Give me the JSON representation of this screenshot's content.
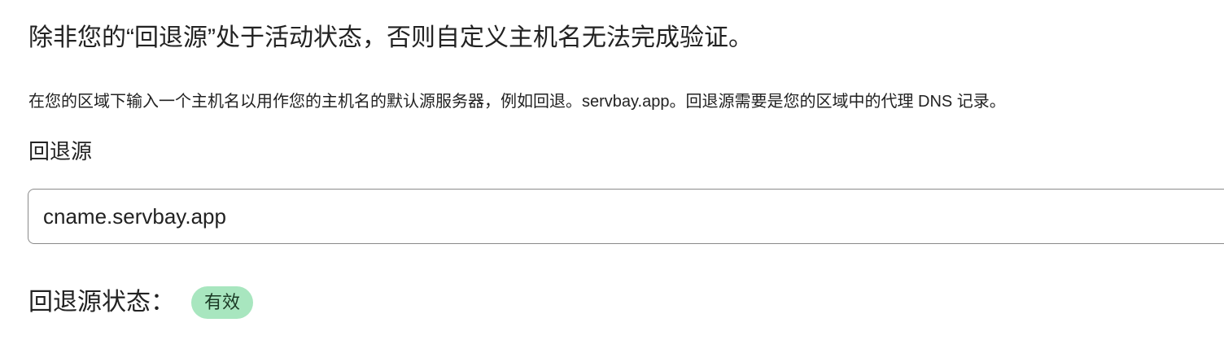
{
  "heading": "除非您的“回退源”处于活动状态，否则自定义主机名无法完成验证。",
  "description": "在您的区域下输入一个主机名以用作您的主机名的默认源服务器，例如回退。servbay.app。回退源需要是您的区域中的代理 DNS 记录。",
  "fallback_origin": {
    "label": "回退源",
    "value": "cname.servbay.app"
  },
  "status": {
    "label": "回退源状态：",
    "badge": "有效",
    "badge_color": "#a8e6bf"
  }
}
